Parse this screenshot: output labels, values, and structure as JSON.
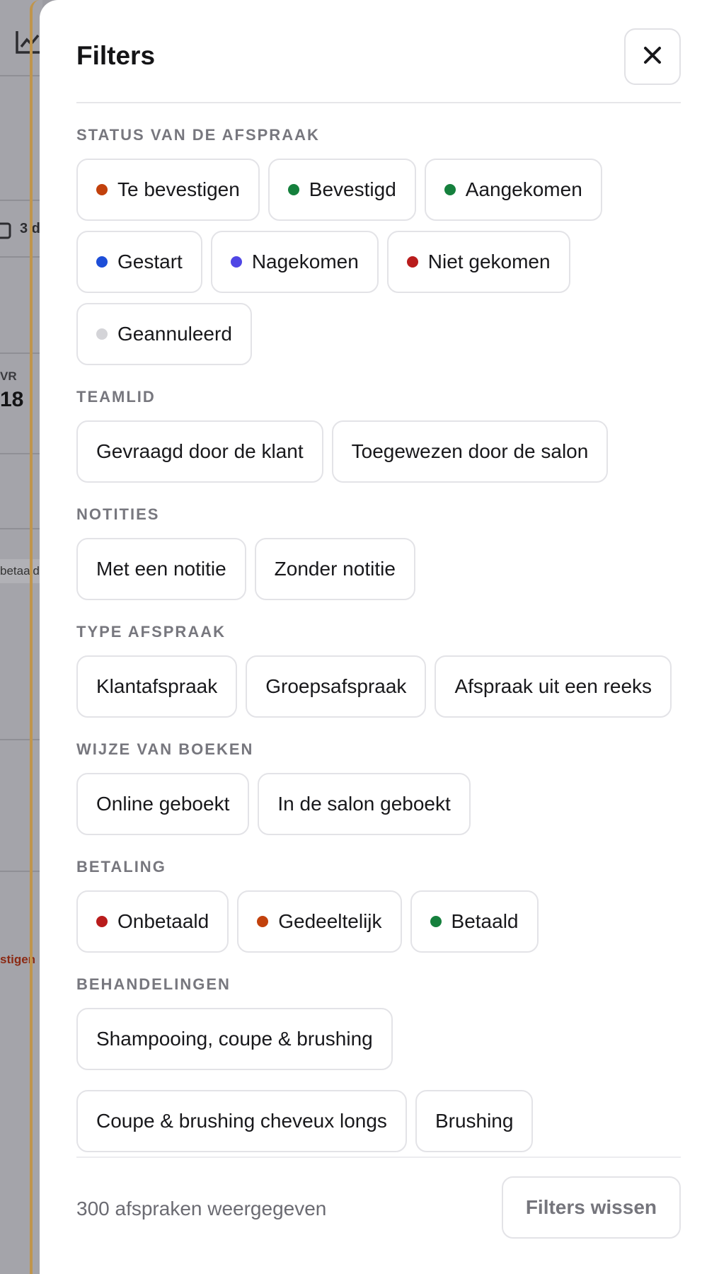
{
  "background": {
    "count_text": "3 d",
    "label_vr": "VR",
    "value_18": "18",
    "chip_betaald": "betaald",
    "status_text": "stigen"
  },
  "header": {
    "title": "Filters"
  },
  "sections": {
    "status": {
      "label": "STATUS VAN DE AFSPRAAK",
      "chips": [
        {
          "label": "Te bevestigen",
          "color": "#c2410c"
        },
        {
          "label": "Bevestigd",
          "color": "#15803d"
        },
        {
          "label": "Aangekomen",
          "color": "#15803d"
        },
        {
          "label": "Gestart",
          "color": "#1d4ed8"
        },
        {
          "label": "Nagekomen",
          "color": "#4f46e5"
        },
        {
          "label": "Niet gekomen",
          "color": "#b91c1c"
        },
        {
          "label": "Geannuleerd",
          "color": "#d4d4d8"
        }
      ]
    },
    "teamlid": {
      "label": "TEAMLID",
      "chips": [
        {
          "label": "Gevraagd door de klant"
        },
        {
          "label": "Toegewezen door de salon"
        }
      ]
    },
    "notities": {
      "label": "NOTITIES",
      "chips": [
        {
          "label": "Met een notitie"
        },
        {
          "label": "Zonder notitie"
        }
      ]
    },
    "type": {
      "label": "TYPE AFSPRAAK",
      "chips": [
        {
          "label": "Klantafspraak"
        },
        {
          "label": "Groepsafspraak"
        },
        {
          "label": "Afspraak uit een reeks"
        }
      ]
    },
    "boeken": {
      "label": "WIJZE VAN BOEKEN",
      "chips": [
        {
          "label": "Online geboekt"
        },
        {
          "label": "In de salon geboekt"
        }
      ]
    },
    "betaling": {
      "label": "BETALING",
      "chips": [
        {
          "label": "Onbetaald",
          "color": "#b91c1c"
        },
        {
          "label": "Gedeeltelijk",
          "color": "#c2410c"
        },
        {
          "label": "Betaald",
          "color": "#15803d"
        }
      ]
    },
    "behandelingen": {
      "label": "BEHANDELINGEN",
      "chips": [
        {
          "label": "Shampooing, coupe & brushing"
        },
        {
          "label": "Coupe & brushing cheveux longs"
        },
        {
          "label": "Brushing"
        }
      ]
    }
  },
  "footer": {
    "count_text": "300 afspraken weergegeven",
    "clear_label": "Filters wissen"
  }
}
